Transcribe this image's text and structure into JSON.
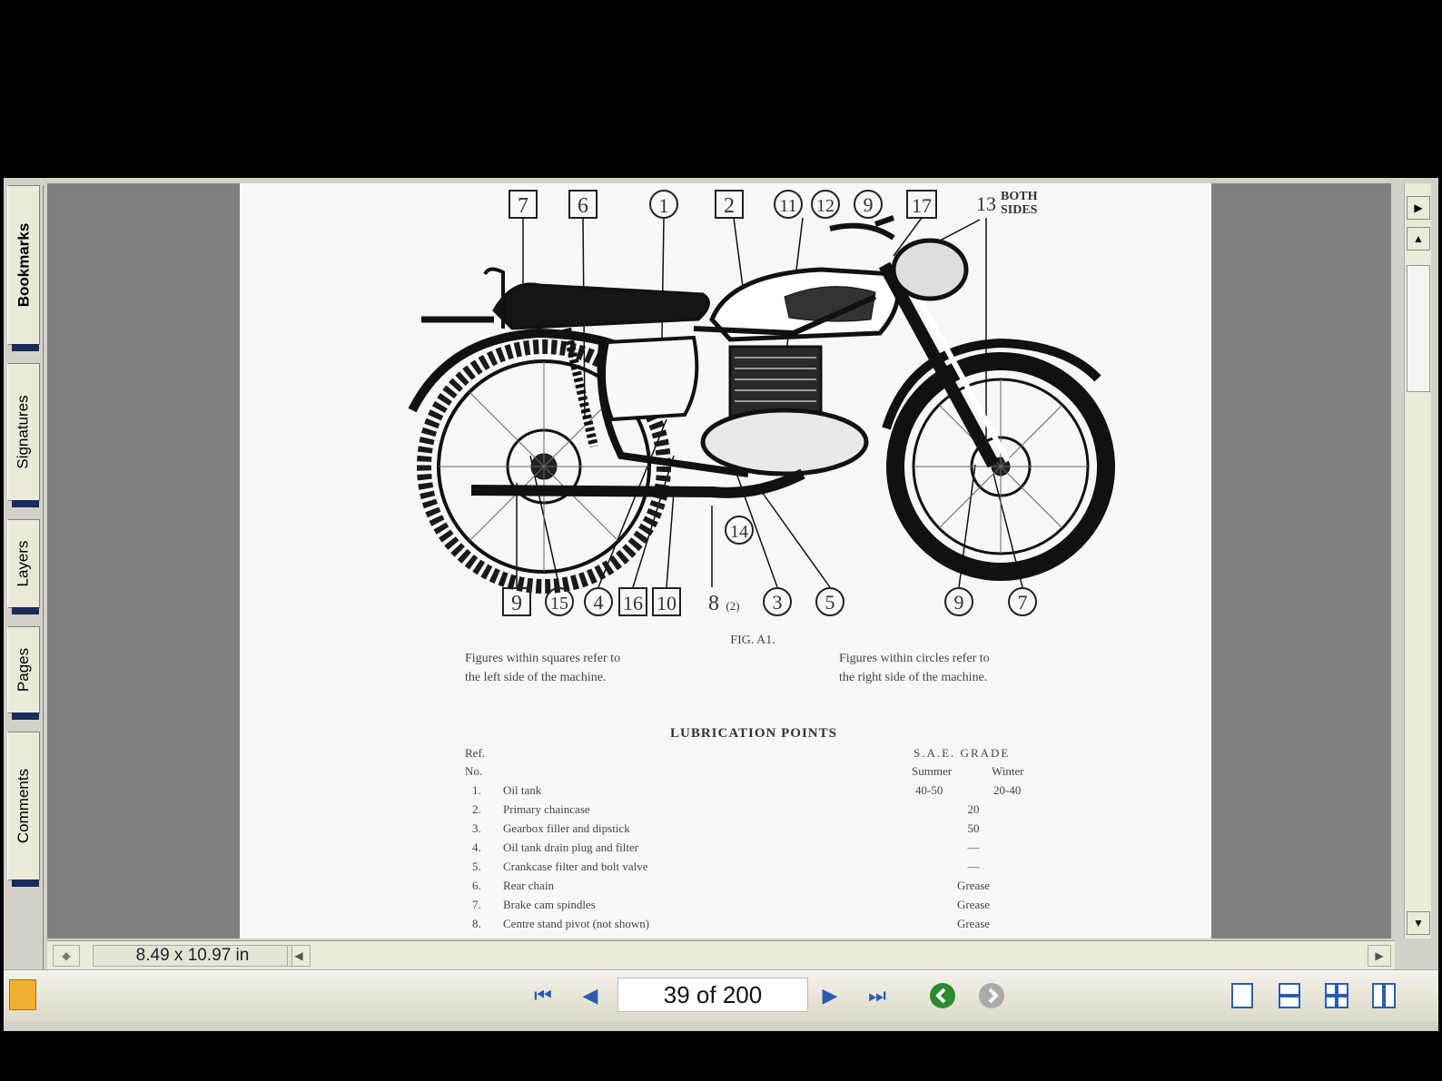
{
  "window": {
    "title": ""
  },
  "side_tabs": [
    {
      "label": "Bookmarks",
      "active": true
    },
    {
      "label": "Signatures",
      "active": false
    },
    {
      "label": "Layers",
      "active": false
    },
    {
      "label": "Pages",
      "active": false
    },
    {
      "label": "Comments",
      "active": false
    }
  ],
  "status": {
    "page_size": "8.49 x 10.97 in"
  },
  "navigation": {
    "page_display": "39 of 200",
    "current_page": 39,
    "total_pages": 200
  },
  "document": {
    "callouts_top": [
      "7",
      "6",
      "1",
      "2",
      "11",
      "12",
      "9",
      "17",
      "13",
      "BOTH",
      "SIDES"
    ],
    "callouts_bottom": [
      "9",
      "15",
      "4",
      "16",
      "10",
      "8",
      "(2)",
      "14",
      "3",
      "5",
      "9",
      "7"
    ],
    "figure_caption": "FIG. A1.",
    "note_left": [
      "Figures within squares refer to",
      "the left side of the machine."
    ],
    "note_right": [
      "Figures within circles refer to",
      "the right side of the machine."
    ],
    "table_title": "LUBRICATION POINTS",
    "col_ref": [
      "Ref.",
      "No."
    ],
    "col_grade": "S.A.E. GRADE",
    "col_summer": "Summer",
    "col_winter": "Winter",
    "rows": [
      {
        "no": "1.",
        "item": "Oil tank",
        "summer": "40-50",
        "winter": "20-40"
      },
      {
        "no": "2.",
        "item": "Primary chaincase",
        "grade": "20"
      },
      {
        "no": "3.",
        "item": "Gearbox filler and dipstick",
        "grade": "50"
      },
      {
        "no": "4.",
        "item": "Oil tank drain plug and filter",
        "grade": "—"
      },
      {
        "no": "5.",
        "item": "Crankcase filter and bolt valve",
        "grade": "—"
      },
      {
        "no": "6.",
        "item": "Rear chain",
        "grade": "Grease"
      },
      {
        "no": "7.",
        "item": "Brake cam spindles",
        "grade": "Grease"
      },
      {
        "no": "8.",
        "item": "Centre stand pivot (not shown)",
        "grade": "Grease"
      }
    ]
  },
  "colors": {
    "accent_blue": "#2a5db0",
    "tab_marker": "#1a2b5c",
    "go_green": "#2e8b2e"
  },
  "icons": [
    "first-page-icon",
    "prev-page-icon",
    "next-page-icon",
    "last-page-icon",
    "go-back-icon",
    "go-forward-icon",
    "single-page-icon",
    "continuous-icon",
    "facing-icon",
    "continuous-facing-icon"
  ]
}
